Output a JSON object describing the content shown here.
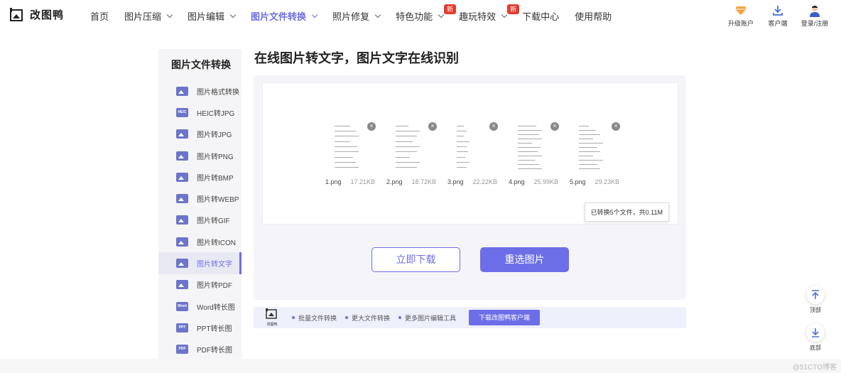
{
  "brand": {
    "name": "改图鸭",
    "accent": "#6c6ee8",
    "badge_color": "#e63b2e"
  },
  "nav": [
    {
      "label": "首页",
      "dropdown": false,
      "active": false
    },
    {
      "label": "图片压缩",
      "dropdown": true,
      "active": false
    },
    {
      "label": "图片编辑",
      "dropdown": true,
      "active": false
    },
    {
      "label": "图片文件转换",
      "dropdown": true,
      "active": true
    },
    {
      "label": "照片修复",
      "dropdown": true,
      "active": false
    },
    {
      "label": "特色功能",
      "dropdown": true,
      "active": false,
      "badge": "新"
    },
    {
      "label": "趣玩特效",
      "dropdown": true,
      "active": false,
      "badge": "新"
    },
    {
      "label": "下载中心",
      "dropdown": false,
      "active": false
    },
    {
      "label": "使用帮助",
      "dropdown": false,
      "active": false
    }
  ],
  "header_tools": [
    {
      "label": "升级账户",
      "icon": "diamond-icon"
    },
    {
      "label": "客户端",
      "icon": "download-icon"
    },
    {
      "label": "登录/注册",
      "icon": "user-avatar-icon"
    }
  ],
  "sidebar": {
    "title": "图片文件转换",
    "items": [
      {
        "label": "图片格式转换",
        "icon": "image-convert-icon",
        "tag": ""
      },
      {
        "label": "HEIC转JPG",
        "icon": "heic-icon",
        "tag": "HEIC"
      },
      {
        "label": "图片转JPG",
        "icon": "jpg-icon",
        "tag": ""
      },
      {
        "label": "图片转PNG",
        "icon": "png-icon",
        "tag": ""
      },
      {
        "label": "图片转BMP",
        "icon": "bmp-icon",
        "tag": ""
      },
      {
        "label": "图片转WEBP",
        "icon": "webp-icon",
        "tag": ""
      },
      {
        "label": "图片转GIF",
        "icon": "gif-icon",
        "tag": ""
      },
      {
        "label": "图片转ICON",
        "icon": "icon-format-icon",
        "tag": ""
      },
      {
        "label": "图片转文字",
        "icon": "text-icon",
        "tag": "",
        "active": true
      },
      {
        "label": "图片转PDF",
        "icon": "pdf-icon",
        "tag": ""
      },
      {
        "label": "Word转长图",
        "icon": "word-icon",
        "tag": "Word"
      },
      {
        "label": "PPT转长图",
        "icon": "ppt-icon",
        "tag": "PPT"
      },
      {
        "label": "PDF转长图",
        "icon": "pdf-long-icon",
        "tag": "PDF"
      }
    ]
  },
  "main": {
    "title": "在线图片转文字，图片文字在线识别",
    "files": [
      {
        "name": "1.png",
        "size": "17.21KB"
      },
      {
        "name": "2.png",
        "size": "18.72KB"
      },
      {
        "name": "3.png",
        "size": "22.22KB"
      },
      {
        "name": "4.png",
        "size": "25.99KB"
      },
      {
        "name": "5.png",
        "size": "29.23KB"
      }
    ],
    "summary": "已转换5个文件，共0.11M",
    "download_label": "立即下载",
    "reselect_label": "重选图片"
  },
  "promo": {
    "logo_text": "改图鸭",
    "features": [
      "批量文件转换",
      "更大文件转换",
      "更多图片编辑工具"
    ],
    "button": "下载改图鸭客户端"
  },
  "float": {
    "top_label": "顶部",
    "bottom_label": "底部"
  },
  "watermark": "@51CTO博客"
}
